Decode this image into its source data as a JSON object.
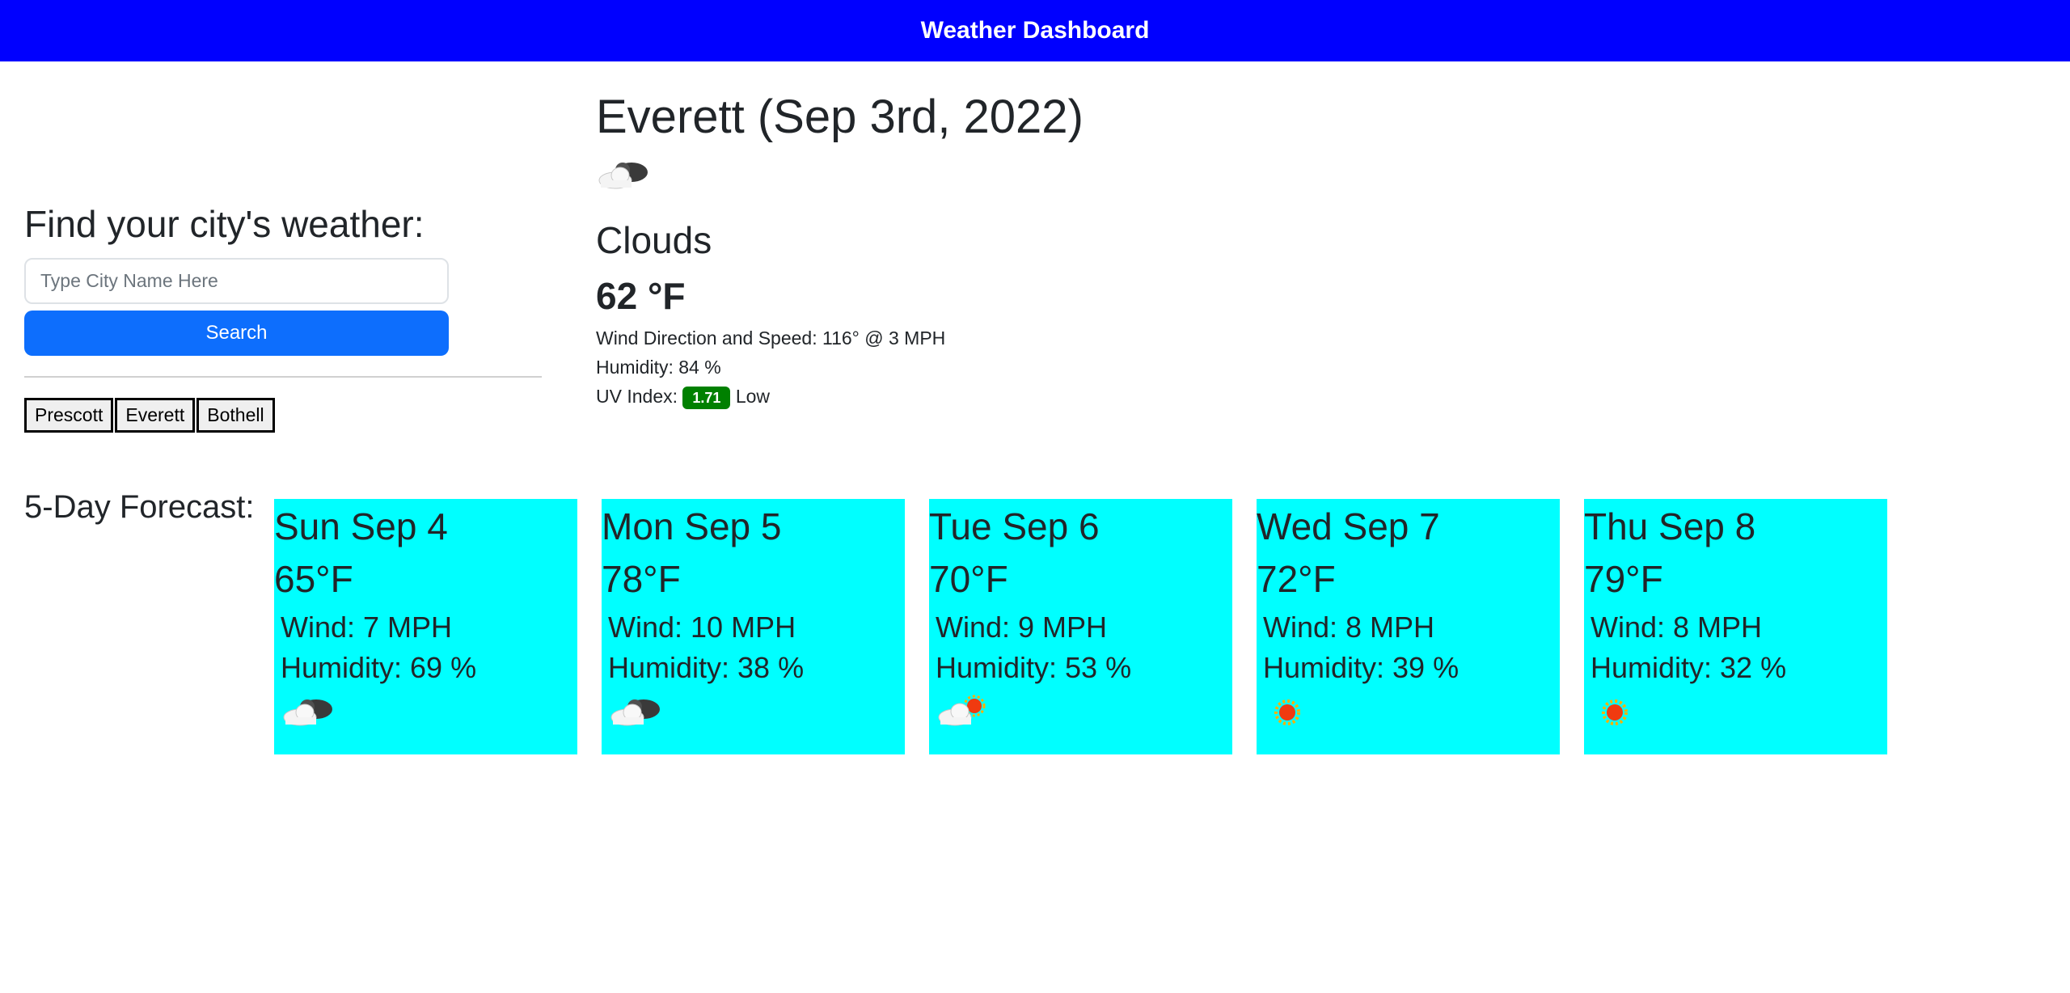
{
  "header": {
    "title": "Weather Dashboard"
  },
  "search": {
    "heading": "Find your city's weather:",
    "placeholder": "Type City Name Here",
    "button_label": "Search"
  },
  "history": [
    "Prescott",
    "Everett",
    "Bothell"
  ],
  "current": {
    "title": "Everett (Sep 3rd, 2022)",
    "icon": "clouds-icon",
    "condition": "Clouds",
    "temp": "62 °F",
    "wind": "Wind Direction and Speed: 116° @ 3 MPH",
    "humidity": "Humidity: 84 %",
    "uv_label": "UV Index:",
    "uv_value": "1.71",
    "uv_level": "Low",
    "uv_color": "#008000"
  },
  "forecast": {
    "label": "5-Day Forecast:",
    "card_color": "#00ffff",
    "days": [
      {
        "date": "Sun Sep 4",
        "temp": "65",
        "unit": "°F",
        "wind": "Wind: 7 MPH",
        "humidity": "Humidity: 69 %",
        "icon": "clouds-icon"
      },
      {
        "date": "Mon Sep 5",
        "temp": "78",
        "unit": "°F",
        "wind": "Wind: 10 MPH",
        "humidity": "Humidity: 38 %",
        "icon": "clouds-icon"
      },
      {
        "date": "Tue Sep 6",
        "temp": "70",
        "unit": "°F",
        "wind": "Wind: 9 MPH",
        "humidity": "Humidity: 53 %",
        "icon": "partly-cloudy-icon"
      },
      {
        "date": "Wed Sep 7",
        "temp": "72",
        "unit": "°F",
        "wind": "Wind: 8 MPH",
        "humidity": "Humidity: 39 %",
        "icon": "sun-icon"
      },
      {
        "date": "Thu Sep 8",
        "temp": "79",
        "unit": "°F",
        "wind": "Wind: 8 MPH",
        "humidity": "Humidity: 32 %",
        "icon": "sun-icon"
      }
    ]
  },
  "colors": {
    "header_bg": "#0000ff",
    "button_bg": "#0d6efd"
  }
}
